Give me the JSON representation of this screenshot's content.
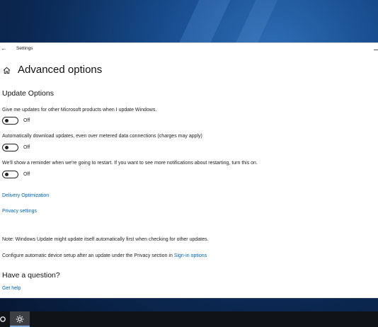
{
  "window": {
    "title": "Settings",
    "back_glyph": "←"
  },
  "page": {
    "title": "Advanced options"
  },
  "update_options": {
    "heading": "Update Options",
    "items": [
      {
        "text": "Give me updates for other Microsoft products when I update Windows.",
        "state": "Off"
      },
      {
        "text": "Automatically download updates, even over metered data connections (charges may apply)",
        "state": "Off"
      },
      {
        "text": "We'll show a reminder when we're going to restart. If you want to see more notifications about restarting, turn this on.",
        "state": "Off"
      }
    ]
  },
  "links": {
    "delivery_optimization": "Delivery Optimization",
    "privacy_settings": "Privacy settings"
  },
  "notes": {
    "note": "Note: Windows Update might update itself automatically first when checking for other updates.",
    "configure_prefix": "Configure automatic device setup after an update under the Privacy section in ",
    "configure_link": "Sign-in options"
  },
  "question": {
    "heading": "Have a question?",
    "link": "Get help"
  },
  "icons": {
    "back": "back-arrow-icon",
    "home": "home-icon",
    "minimize": "minimize-icon",
    "gear": "gear-icon",
    "cortana": "cortana-icon"
  },
  "colors": {
    "link": "#0063b1",
    "window_bg": "#ffffff",
    "taskbar_bg": "#101418",
    "desktop_accent": "#174b8c"
  }
}
